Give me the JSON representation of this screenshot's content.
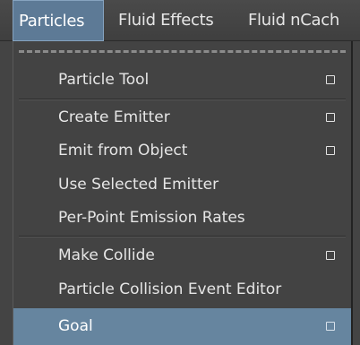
{
  "menubar": {
    "items": [
      {
        "label": "Particles",
        "active": true
      },
      {
        "label": "Fluid Effects",
        "active": false
      },
      {
        "label": "Fluid nCach",
        "active": false
      }
    ]
  },
  "menu": {
    "items": [
      {
        "label": "Particle Tool",
        "has_option_box": true
      },
      {
        "label": "Create Emitter",
        "has_option_box": true
      },
      {
        "label": "Emit from Object",
        "has_option_box": true
      },
      {
        "label": "Use Selected Emitter",
        "has_option_box": false
      },
      {
        "label": "Per-Point Emission Rates",
        "has_option_box": false
      },
      {
        "label": "Make Collide",
        "has_option_box": true
      },
      {
        "label": "Particle Collision Event Editor",
        "has_option_box": false
      },
      {
        "label": "Goal",
        "has_option_box": true,
        "highlighted": true
      }
    ]
  },
  "colors": {
    "menu_background": "#434343",
    "highlight": "#66859f",
    "active_menubar": "#5d7a96",
    "text": "#e6e6e6"
  }
}
